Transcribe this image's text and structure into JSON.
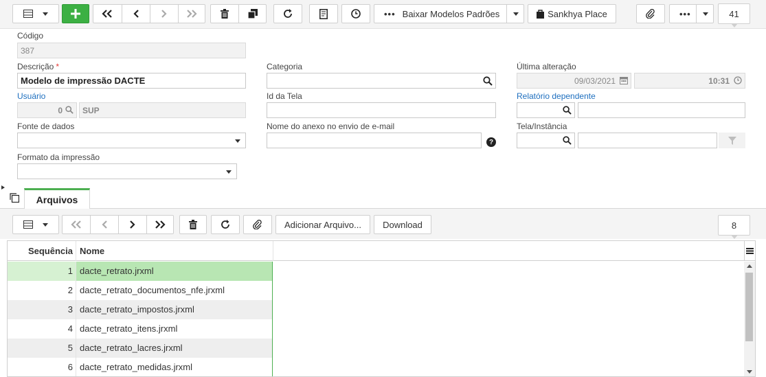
{
  "toolbar": {
    "baixar_label": "Baixar Modelos Padrões",
    "sankhya_label": "Sankhya Place",
    "record_count": "41"
  },
  "form": {
    "codigo": {
      "label": "Código",
      "value": "387"
    },
    "descricao": {
      "label": "Descrição",
      "required": "*",
      "value": "Modelo de impressão DACTE"
    },
    "categoria": {
      "label": "Categoria",
      "value": ""
    },
    "ultima_alteracao": {
      "label": "Última alteração",
      "date": "09/03/2021",
      "time": "10:31"
    },
    "usuario": {
      "label": "Usuário",
      "code": "0",
      "name": "SUP"
    },
    "id_tela": {
      "label": "Id da Tela",
      "value": ""
    },
    "relatorio_dependente": {
      "label": "Relatório dependente",
      "value": ""
    },
    "fonte_dados": {
      "label": "Fonte de dados",
      "value": ""
    },
    "nome_anexo": {
      "label": "Nome do anexo no envio de e-mail",
      "value": "",
      "help": "?"
    },
    "tela_instancia": {
      "label": "Tela/Instância",
      "value": ""
    },
    "formato_impressao": {
      "label": "Formato da impressão",
      "value": ""
    }
  },
  "tabs": [
    {
      "label": "Arquivos"
    }
  ],
  "subtoolbar": {
    "adicionar_label": "Adicionar Arquivo...",
    "download_label": "Download",
    "count": "8"
  },
  "grid": {
    "columns": [
      "Sequência",
      "Nome"
    ],
    "rows": [
      {
        "seq": "1",
        "nome": "dacte_retrato.jrxml"
      },
      {
        "seq": "2",
        "nome": "dacte_retrato_documentos_nfe.jrxml"
      },
      {
        "seq": "3",
        "nome": "dacte_retrato_impostos.jrxml"
      },
      {
        "seq": "4",
        "nome": "dacte_retrato_itens.jrxml"
      },
      {
        "seq": "5",
        "nome": "dacte_retrato_lacres.jrxml"
      },
      {
        "seq": "6",
        "nome": "dacte_retrato_medidas.jrxml"
      }
    ]
  },
  "colors": {
    "accent_green": "#3cb043",
    "link_blue": "#1e6fbf",
    "selected_row": "#b8e6b3"
  }
}
